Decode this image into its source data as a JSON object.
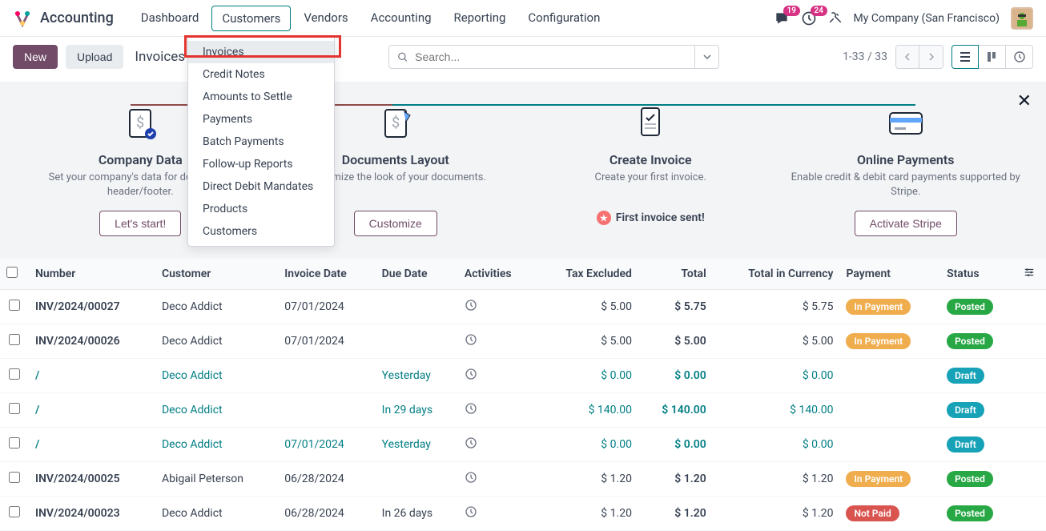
{
  "nav": {
    "app": "Accounting",
    "items": [
      "Dashboard",
      "Customers",
      "Vendors",
      "Accounting",
      "Reporting",
      "Configuration"
    ],
    "badges": {
      "messages": "19",
      "activities": "24"
    },
    "company": "My Company (San Francisco)"
  },
  "toolbar": {
    "new": "New",
    "upload": "Upload",
    "breadcrumb": "Invoices",
    "search_placeholder": "Search...",
    "pager": "1-33 / 33"
  },
  "dropdown": {
    "items": [
      "Invoices",
      "Credit Notes",
      "Amounts to Settle",
      "Payments",
      "Batch Payments",
      "Follow-up Reports",
      "Direct Debit Mandates",
      "Products",
      "Customers"
    ]
  },
  "onboard": {
    "steps": [
      {
        "title": "Company Data",
        "desc": "Set your company's data for documents header/footer.",
        "btn": "Let's start!"
      },
      {
        "title": "Documents Layout",
        "desc": "Customize the look of your documents.",
        "btn": "Customize"
      },
      {
        "title": "Create Invoice",
        "desc": "Create your first invoice.",
        "badge": "First invoice sent!"
      },
      {
        "title": "Online Payments",
        "desc": "Enable credit & debit card payments supported by Stripe.",
        "btn": "Activate Stripe"
      }
    ]
  },
  "table": {
    "headers": {
      "number": "Number",
      "customer": "Customer",
      "invoice_date": "Invoice Date",
      "due_date": "Due Date",
      "activities": "Activities",
      "tax_excluded": "Tax Excluded",
      "total": "Total",
      "total_currency": "Total in Currency",
      "payment": "Payment",
      "status": "Status"
    },
    "payment_labels": {
      "in_payment": "In Payment",
      "not_paid": "Not Paid"
    },
    "status_labels": {
      "posted": "Posted",
      "draft": "Draft"
    },
    "rows": [
      {
        "number": "INV/2024/00027",
        "customer": "Deco Addict",
        "invoice_date": "07/01/2024",
        "due_date": "",
        "tax_excluded": "$ 5.00",
        "total": "$ 5.75",
        "total_currency": "$ 5.75",
        "payment": "in_payment",
        "status": "posted",
        "draft": false
      },
      {
        "number": "INV/2024/00026",
        "customer": "Deco Addict",
        "invoice_date": "07/01/2024",
        "due_date": "",
        "tax_excluded": "$ 5.00",
        "total": "$ 5.00",
        "total_currency": "$ 5.00",
        "payment": "in_payment",
        "status": "posted",
        "draft": false
      },
      {
        "number": "/",
        "customer": "Deco Addict",
        "invoice_date": "",
        "due_date": "Yesterday",
        "due_overdue": true,
        "tax_excluded": "$ 0.00",
        "total": "$ 0.00",
        "total_currency": "$ 0.00",
        "payment": "",
        "status": "draft",
        "draft": true
      },
      {
        "number": "/",
        "customer": "Deco Addict",
        "invoice_date": "",
        "due_date": "In 29 days",
        "tax_excluded": "$ 140.00",
        "total": "$ 140.00",
        "total_currency": "$ 140.00",
        "payment": "",
        "status": "draft",
        "draft": true
      },
      {
        "number": "/",
        "customer": "Deco Addict",
        "invoice_date": "07/01/2024",
        "due_date": "Yesterday",
        "due_overdue": true,
        "tax_excluded": "$ 0.00",
        "total": "$ 0.00",
        "total_currency": "$ 0.00",
        "payment": "",
        "status": "draft",
        "draft": true
      },
      {
        "number": "INV/2024/00025",
        "customer": "Abigail Peterson",
        "invoice_date": "06/28/2024",
        "due_date": "",
        "tax_excluded": "$ 1.20",
        "total": "$ 1.20",
        "total_currency": "$ 1.20",
        "payment": "in_payment",
        "status": "posted",
        "draft": false
      },
      {
        "number": "INV/2024/00023",
        "customer": "Deco Addict",
        "invoice_date": "06/28/2024",
        "due_date": "In 26 days",
        "tax_excluded": "$ 1.20",
        "total": "$ 1.20",
        "total_currency": "$ 1.20",
        "payment": "not_paid",
        "status": "posted",
        "draft": false
      }
    ]
  }
}
